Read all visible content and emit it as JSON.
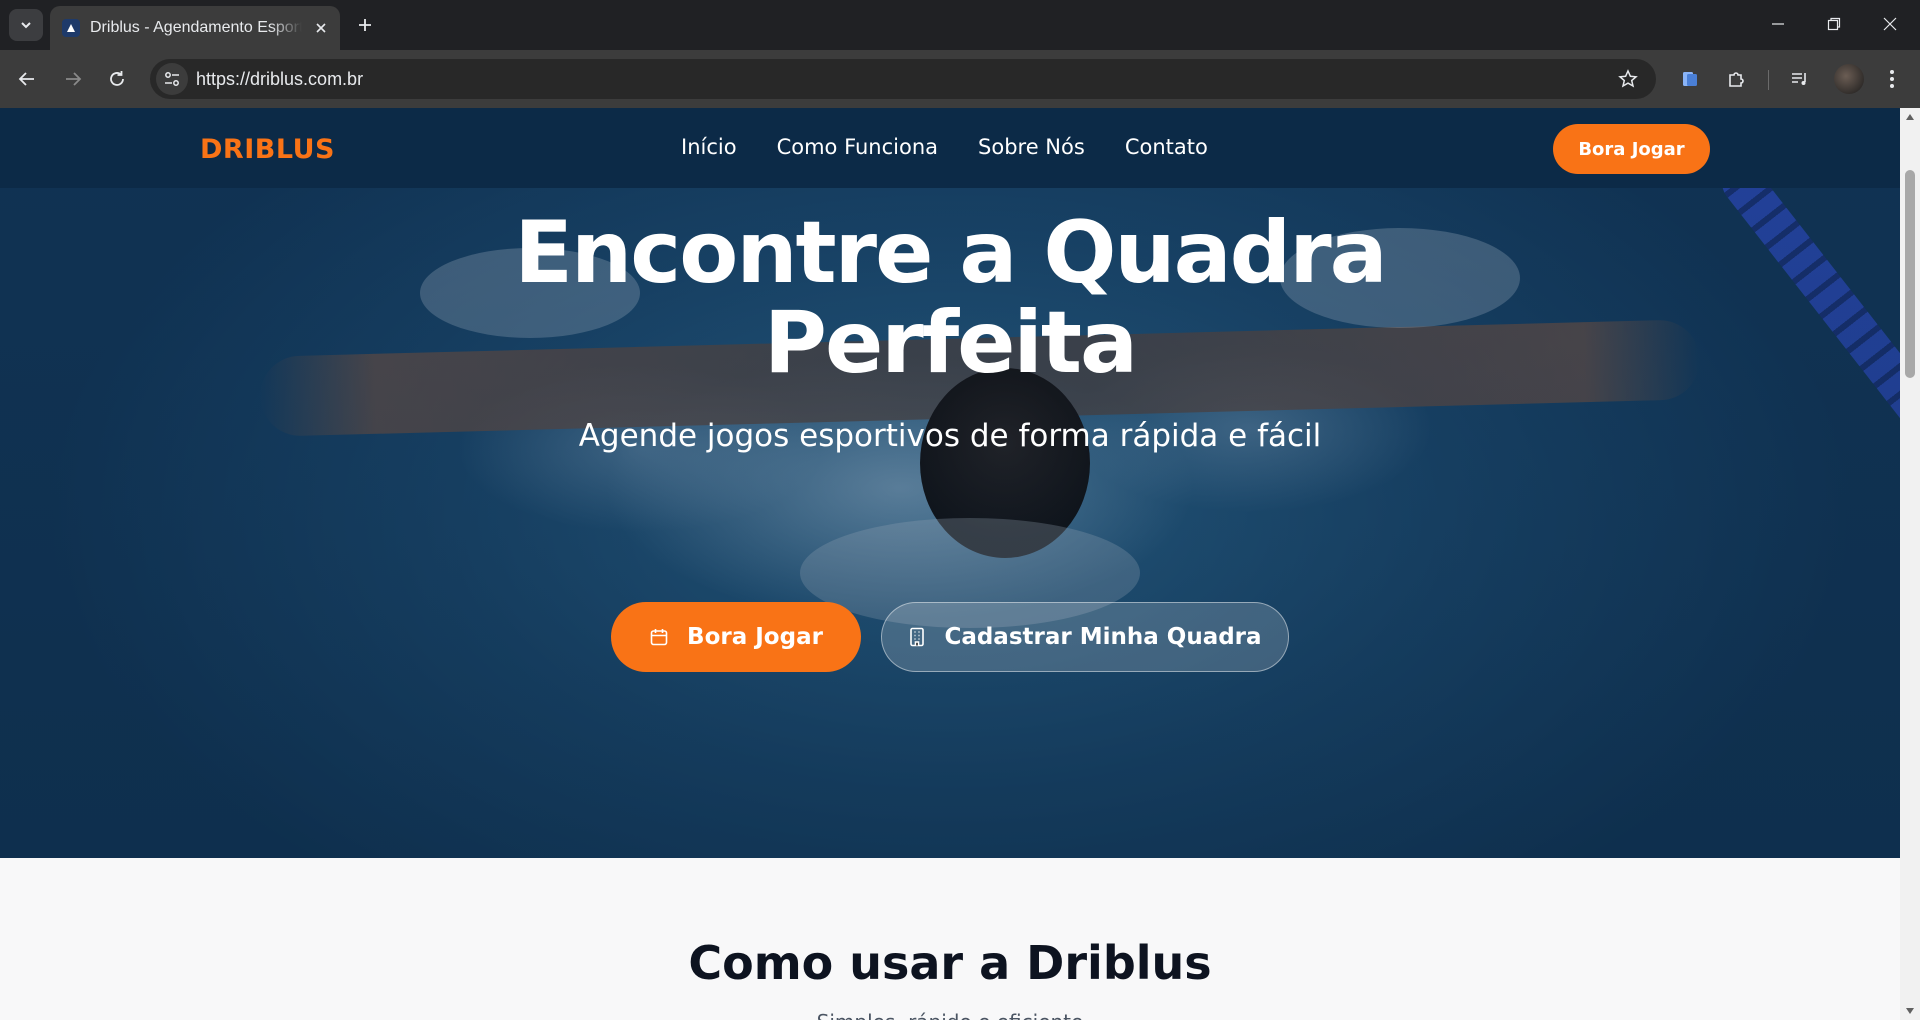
{
  "browser": {
    "tab_title": "Driblus - Agendamento Esportivo",
    "url": "https://driblus.com.br"
  },
  "site": {
    "logo": "DRIBLUS",
    "nav": [
      "Início",
      "Como Funciona",
      "Sobre Nós",
      "Contato"
    ],
    "header_cta": "Bora Jogar"
  },
  "hero": {
    "title_line1": "Encontre a Quadra",
    "title_line2": "Perfeita",
    "subtitle": "Agende jogos esportivos de forma rápida e fácil",
    "primary_button": "Bora Jogar",
    "secondary_button": "Cadastrar Minha Quadra"
  },
  "section": {
    "title": "Como usar a Driblus",
    "subtitle": "Simples, rápido e eficiente"
  },
  "colors": {
    "brand_orange": "#f97316",
    "header_navy": "#0c2a47"
  },
  "icons": [
    "chevron-down-icon",
    "favicon-icon",
    "close-icon",
    "plus-icon",
    "minimize-icon",
    "restore-icon",
    "back-icon",
    "forward-icon",
    "reload-icon",
    "site-info-icon",
    "star-icon",
    "extension-icon",
    "puzzle-icon",
    "media-icon",
    "menu-icon",
    "calendar-icon",
    "building-icon"
  ]
}
